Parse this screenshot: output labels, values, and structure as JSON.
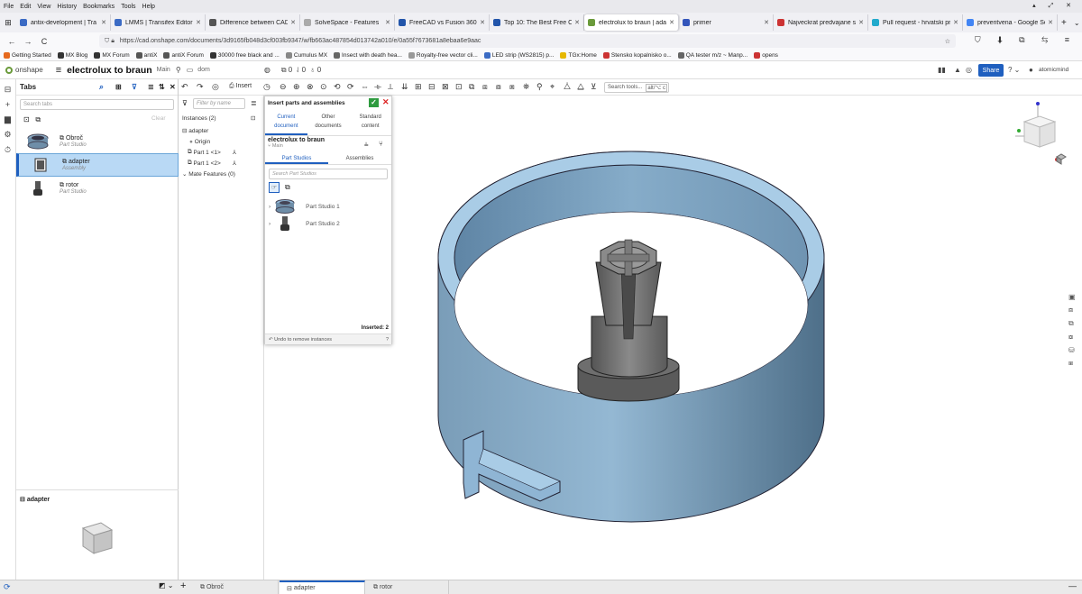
{
  "menubar": [
    "File",
    "Edit",
    "View",
    "History",
    "Bookmarks",
    "Tools",
    "Help"
  ],
  "browser_tabs": [
    {
      "label": "antix-development | Tra",
      "color": "#3b6bc4"
    },
    {
      "label": "LMMS | Transifex Editor",
      "color": "#3b6bc4"
    },
    {
      "label": "Difference between CAD",
      "color": "#555555"
    },
    {
      "label": "SolveSpace - Features",
      "color": "#aaaaaa"
    },
    {
      "label": "FreeCAD vs Fusion 360: T",
      "color": "#2255aa"
    },
    {
      "label": "Top 10: The Best Free CA",
      "color": "#2255aa"
    },
    {
      "label": "electrolux to braun | adap",
      "color": "#6a9a3a",
      "active": true
    },
    {
      "label": "primer",
      "color": "#3355bb"
    },
    {
      "label": "Najveckrat predvajane sl",
      "color": "#cc3333"
    },
    {
      "label": "Pull request - hrvatski pr",
      "color": "#22aacc"
    },
    {
      "label": "preveritvena - Google Se",
      "color": "#4285f4"
    }
  ],
  "url": "https://cad.onshape.com/documents/3d9165fb048d3cf003fb9347/w/fb663ac487854d013742a010/e/0a55f7673681a8ebaa6e9aac",
  "bookmarks": [
    {
      "label": "Getting Started",
      "color": "#e66a1f"
    },
    {
      "label": "MX Blog",
      "color": "#333333"
    },
    {
      "label": "MX Forum",
      "color": "#333333"
    },
    {
      "label": "antiX",
      "color": "#555555"
    },
    {
      "label": "antiX Forum",
      "color": "#555555"
    },
    {
      "label": "30000 free black and ...",
      "color": "#333333"
    },
    {
      "label": "Cumulus MX",
      "color": "#888888"
    },
    {
      "label": "Insect with death hea...",
      "color": "#666666"
    },
    {
      "label": "Royalty-free vector cli...",
      "color": "#999999"
    },
    {
      "label": "LED strip (WS2815) p...",
      "color": "#3b6bc4"
    },
    {
      "label": "TGx:Home",
      "color": "#e6b800"
    },
    {
      "label": "Stensko kopalnisko o...",
      "color": "#cc3333"
    },
    {
      "label": "QA tester m/z ~ Manp...",
      "color": "#666666"
    },
    {
      "label": "opens",
      "color": "#cc3333"
    }
  ],
  "header": {
    "app": "onshape",
    "title": "electrolux to braun",
    "branch": "Main",
    "folder": "dom",
    "share": "Share",
    "user": "atomicmind",
    "counts": "0   0   0"
  },
  "toolbar": {
    "insert": "Insert",
    "search_tools": "Search tools...",
    "shortcut": "alt/⌥ c"
  },
  "tabs_panel": {
    "title": "Tabs",
    "search_placeholder": "Search tabs",
    "clear": "Clear",
    "items": [
      {
        "name": "Obroč",
        "type": "Part Studio"
      },
      {
        "name": "adapter",
        "type": "Assembly",
        "selected": true
      },
      {
        "name": "rotor",
        "type": "Part Studio"
      }
    ],
    "preview_label": "adapter"
  },
  "instances": {
    "filter_placeholder": "Filter by name",
    "header": "Instances (2)",
    "rows": [
      "adapter",
      "Origin",
      "Part 1 <1>",
      "Part 1 <2>",
      "Mate Features (0)"
    ]
  },
  "dialog": {
    "title": "Insert parts and assemblies",
    "tabs": [
      [
        "Current",
        "document"
      ],
      [
        "Other",
        "documents"
      ],
      [
        "Standard",
        "content"
      ]
    ],
    "doc_name": "electrolux to braun",
    "doc_branch": "Main",
    "subtabs": [
      "Part Studios",
      "Assemblies"
    ],
    "search_placeholder": "Search Part Studios",
    "items": [
      "Part Studio 1",
      "Part Studio 2"
    ],
    "inserted": "Inserted: 2",
    "undo": "Undo to remove instances"
  },
  "bottom_tabs": [
    "Obroč",
    "adapter",
    "rotor"
  ],
  "colors": {
    "model_blue": "#8fb5d4",
    "accent": "#1f5fbf",
    "selected": "#b9d9f5"
  }
}
